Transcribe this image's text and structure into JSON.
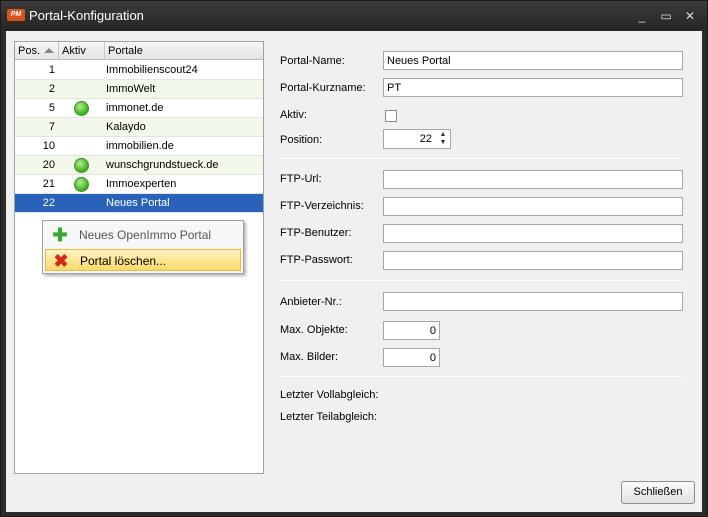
{
  "window": {
    "title": "Portal-Konfiguration",
    "logo": "PM",
    "buttons": {
      "minimize": "_",
      "maximize": "▭",
      "close": "✕"
    }
  },
  "list": {
    "columns": {
      "pos": "Pos.",
      "aktiv": "Aktiv",
      "portale": "Portale"
    },
    "rows": [
      {
        "pos": "1",
        "aktiv": false,
        "name": "Immobilienscout24"
      },
      {
        "pos": "2",
        "aktiv": false,
        "name": "ImmoWelt"
      },
      {
        "pos": "5",
        "aktiv": true,
        "name": "immonet.de"
      },
      {
        "pos": "7",
        "aktiv": false,
        "name": "Kalaydo"
      },
      {
        "pos": "10",
        "aktiv": false,
        "name": "immobilien.de"
      },
      {
        "pos": "20",
        "aktiv": true,
        "name": "wunschgrundstueck.de"
      },
      {
        "pos": "21",
        "aktiv": true,
        "name": "Immoexperten"
      },
      {
        "pos": "22",
        "aktiv": false,
        "name": "Neues Portal"
      }
    ]
  },
  "context_menu": {
    "new_portal": "Neues OpenImmo Portal",
    "delete_portal": "Portal löschen..."
  },
  "form": {
    "portal_name_label": "Portal-Name:",
    "portal_name_value": "Neues Portal",
    "kurzname_label": "Portal-Kurzname:",
    "kurzname_value": "PT",
    "aktiv_label": "Aktiv:",
    "position_label": "Position:",
    "position_value": "22",
    "ftp_url_label": "FTP-Url:",
    "ftp_verzeichnis_label": "FTP-Verzeichnis:",
    "ftp_benutzer_label": "FTP-Benutzer:",
    "ftp_passwort_label": "FTP-Passwort:",
    "anbieter_label": "Anbieter-Nr.:",
    "max_objekte_label": "Max. Objekte:",
    "max_objekte_value": "0",
    "max_bilder_label": "Max. Bilder:",
    "max_bilder_value": "0",
    "letzter_voll_label": "Letzter Vollabgleich:",
    "letzter_teil_label": "Letzter Teilabgleich:"
  },
  "close_button": "Schließen"
}
